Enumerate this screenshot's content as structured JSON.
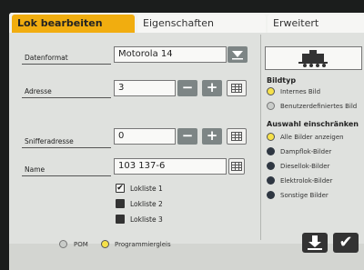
{
  "tabs": [
    {
      "label": "Lok bearbeiten",
      "active": true
    },
    {
      "label": "Eigenschaften",
      "active": false
    },
    {
      "label": "Erweitert",
      "active": false
    }
  ],
  "form": {
    "datenformat": {
      "label": "Datenformat",
      "value": "Motorola 14"
    },
    "adresse": {
      "label": "Adresse",
      "value": "3"
    },
    "snifferadresse": {
      "label": "Snifferadresse",
      "value": "0"
    },
    "name": {
      "label": "Name",
      "value": "103 137-6"
    },
    "buttons": {
      "minus": "−",
      "plus": "+"
    }
  },
  "loklisten": [
    {
      "label": "Lokliste 1",
      "checked": true
    },
    {
      "label": "Lokliste 2",
      "checked": false
    },
    {
      "label": "Lokliste 3",
      "checked": false
    }
  ],
  "bildtyp": {
    "title": "Bildtyp",
    "options": [
      {
        "label": "Internes Bild",
        "selected": true
      },
      {
        "label": "Benutzerdefiniertes Bild",
        "selected": false
      }
    ]
  },
  "auswahl": {
    "title": "Auswahl einschränken",
    "options": [
      {
        "label": "Alle Bilder anzeigen",
        "selected": true
      },
      {
        "label": "Dampflok-Bilder",
        "selected": false
      },
      {
        "label": "Diesellok-Bilder",
        "selected": false
      },
      {
        "label": "Elektrolok-Bilder",
        "selected": false
      },
      {
        "label": "Sonstige Bilder",
        "selected": false
      }
    ]
  },
  "track": {
    "options": [
      {
        "label": "POM",
        "selected": false
      },
      {
        "label": "Programmiergleis",
        "selected": true
      }
    ]
  },
  "actions": {
    "confirm": "✔",
    "save_icon": "download-icon"
  },
  "colors": {
    "tab_active": "#f1ad0f",
    "radio_selected": "#f6e14a",
    "radio_dark": "#2f3742"
  }
}
